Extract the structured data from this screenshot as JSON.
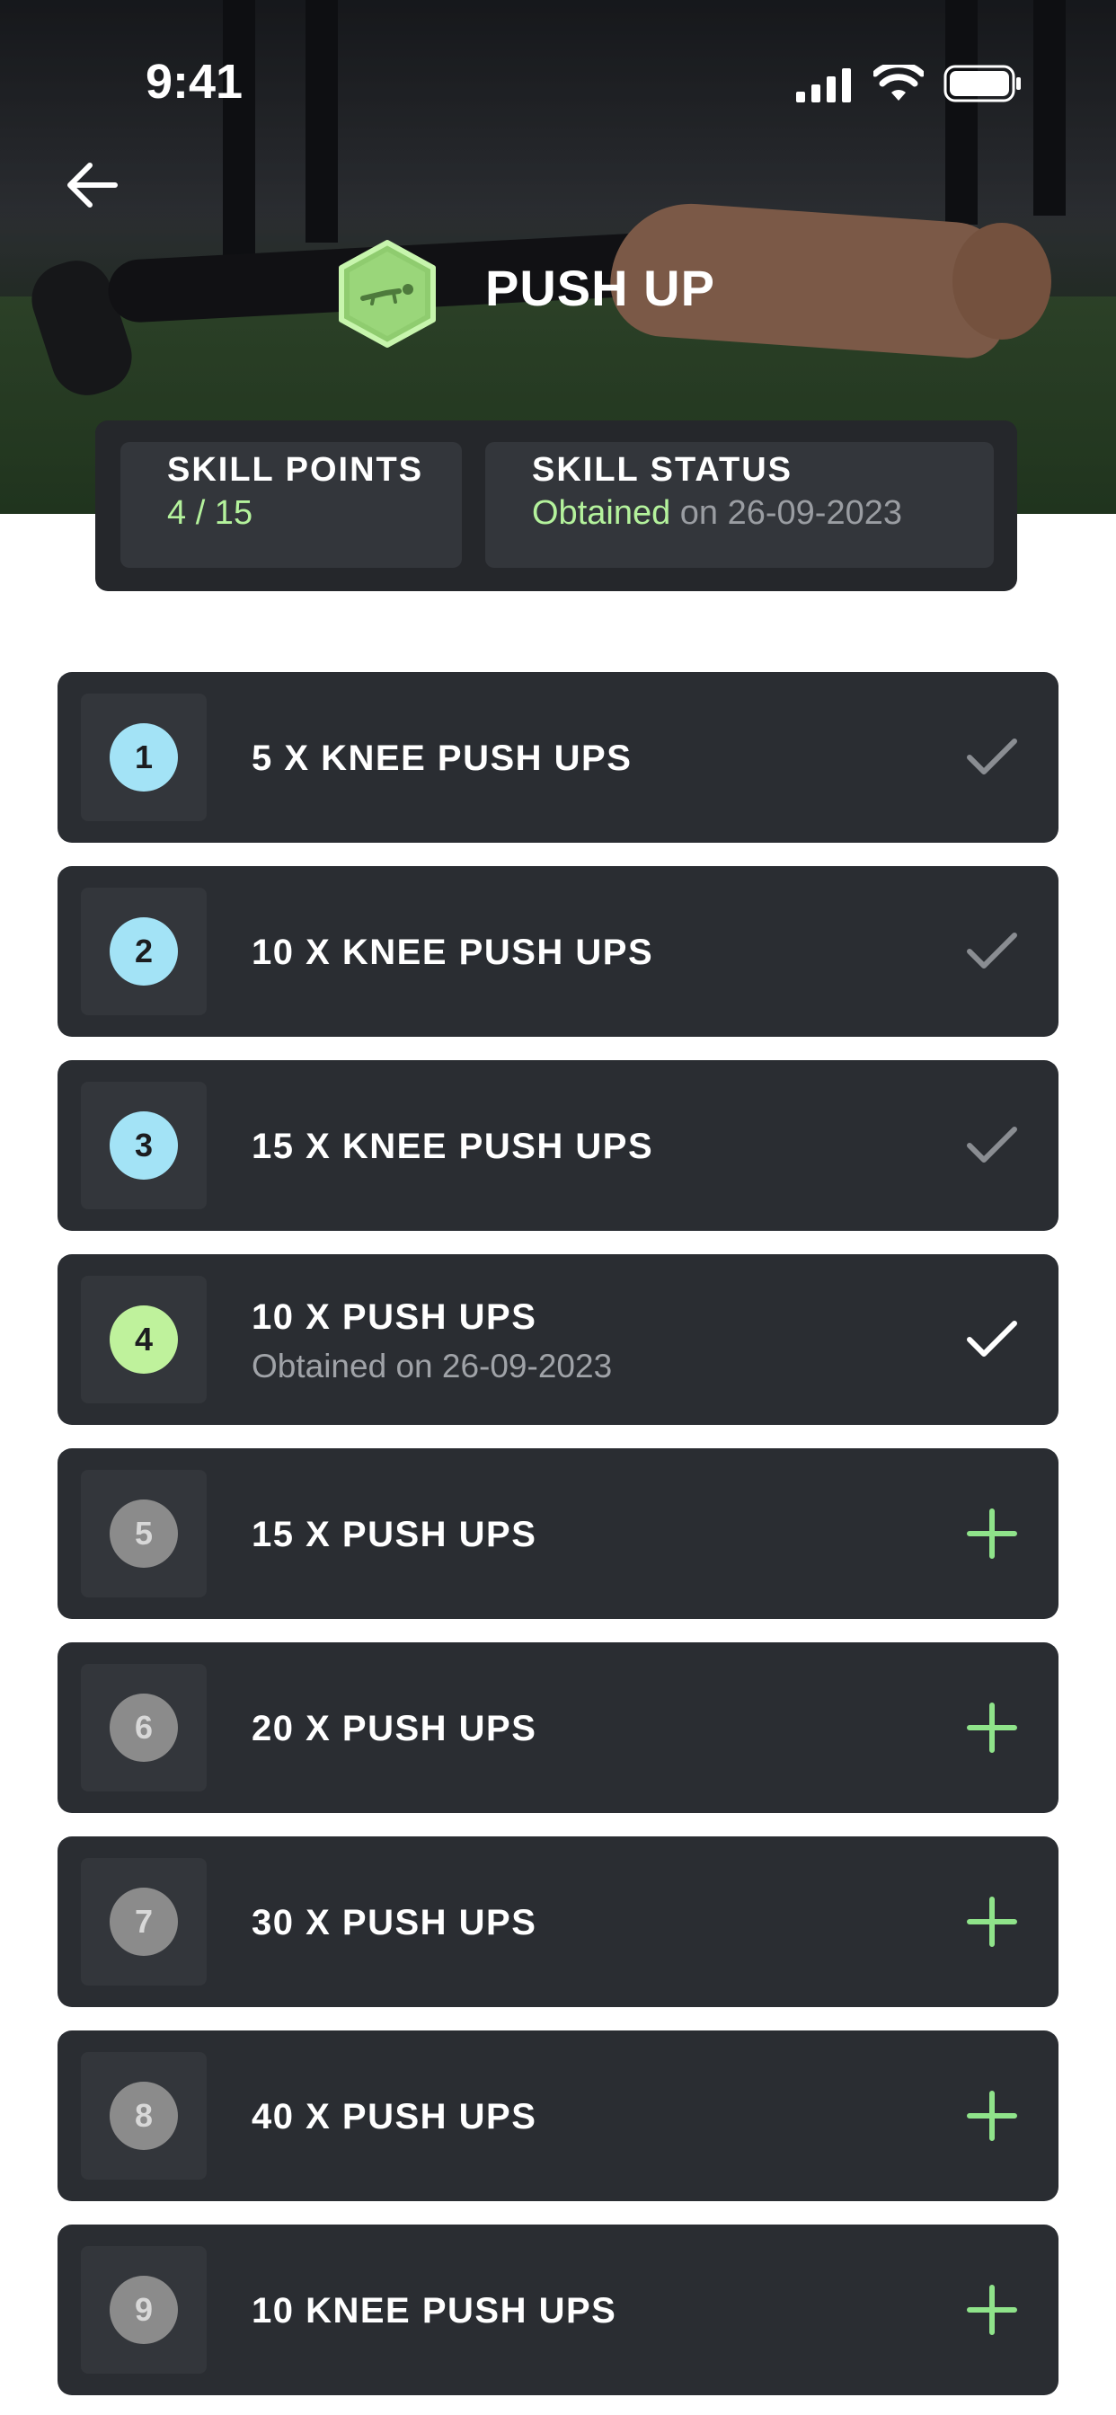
{
  "status_bar": {
    "time": "9:41"
  },
  "header": {
    "title": "PUSH UP",
    "badge_icon": "push-up-icon",
    "back_icon": "arrow-left-icon"
  },
  "summary": {
    "points_label": "SKILL POINTS",
    "points_value": "4 / 15",
    "status_label": "SKILL STATUS",
    "status_value": "Obtained",
    "status_date": "on 26-09-2023"
  },
  "colors": {
    "accent_green": "#b4f29c",
    "done_blue": "#a3e3f6",
    "pending_grey": "#8b8b8b",
    "card_bg": "#2a2d32"
  },
  "levels": [
    {
      "number": "1",
      "label": "5 X KNEE PUSH UPS",
      "state": "done",
      "action_icon": "check-icon"
    },
    {
      "number": "2",
      "label": "10 X KNEE PUSH UPS",
      "state": "done",
      "action_icon": "check-icon"
    },
    {
      "number": "3",
      "label": "15 X KNEE PUSH UPS",
      "state": "done",
      "action_icon": "check-icon"
    },
    {
      "number": "4",
      "label": "10 X PUSH UPS",
      "subtitle": "Obtained on 26-09-2023",
      "state": "current",
      "action_icon": "check-icon"
    },
    {
      "number": "5",
      "label": "15 X PUSH UPS",
      "state": "pending",
      "action_icon": "plus-icon"
    },
    {
      "number": "6",
      "label": "20 X PUSH UPS",
      "state": "pending",
      "action_icon": "plus-icon"
    },
    {
      "number": "7",
      "label": "30 X PUSH UPS",
      "state": "pending",
      "action_icon": "plus-icon"
    },
    {
      "number": "8",
      "label": "40 X PUSH UPS",
      "state": "pending",
      "action_icon": "plus-icon"
    },
    {
      "number": "9",
      "label": "10 KNEE PUSH UPS",
      "state": "pending",
      "action_icon": "plus-icon"
    }
  ]
}
